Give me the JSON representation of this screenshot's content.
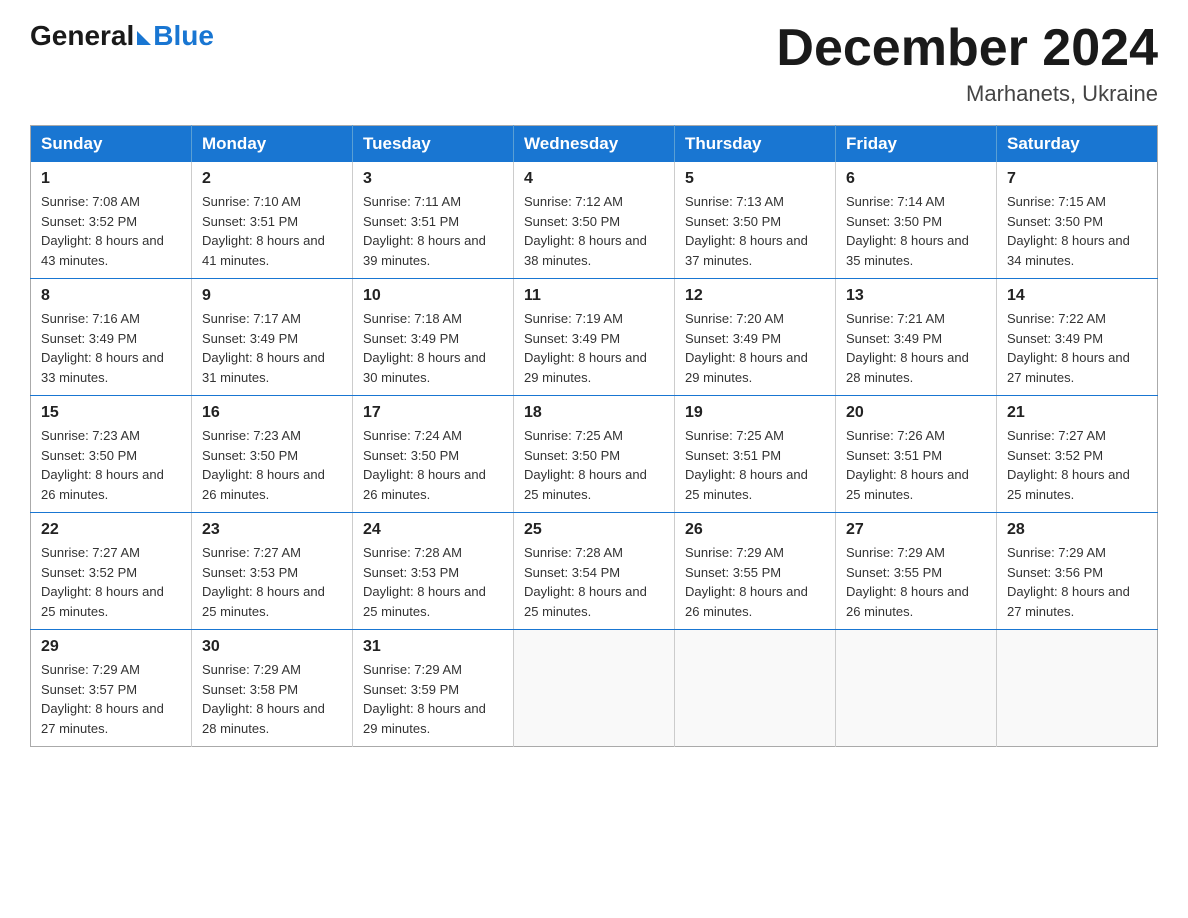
{
  "header": {
    "logo": {
      "general": "General",
      "blue": "Blue"
    },
    "title": "December 2024",
    "location": "Marhanets, Ukraine"
  },
  "calendar": {
    "days_of_week": [
      "Sunday",
      "Monday",
      "Tuesday",
      "Wednesday",
      "Thursday",
      "Friday",
      "Saturday"
    ],
    "weeks": [
      [
        {
          "day": "1",
          "sunrise": "7:08 AM",
          "sunset": "3:52 PM",
          "daylight": "8 hours and 43 minutes."
        },
        {
          "day": "2",
          "sunrise": "7:10 AM",
          "sunset": "3:51 PM",
          "daylight": "8 hours and 41 minutes."
        },
        {
          "day": "3",
          "sunrise": "7:11 AM",
          "sunset": "3:51 PM",
          "daylight": "8 hours and 39 minutes."
        },
        {
          "day": "4",
          "sunrise": "7:12 AM",
          "sunset": "3:50 PM",
          "daylight": "8 hours and 38 minutes."
        },
        {
          "day": "5",
          "sunrise": "7:13 AM",
          "sunset": "3:50 PM",
          "daylight": "8 hours and 37 minutes."
        },
        {
          "day": "6",
          "sunrise": "7:14 AM",
          "sunset": "3:50 PM",
          "daylight": "8 hours and 35 minutes."
        },
        {
          "day": "7",
          "sunrise": "7:15 AM",
          "sunset": "3:50 PM",
          "daylight": "8 hours and 34 minutes."
        }
      ],
      [
        {
          "day": "8",
          "sunrise": "7:16 AM",
          "sunset": "3:49 PM",
          "daylight": "8 hours and 33 minutes."
        },
        {
          "day": "9",
          "sunrise": "7:17 AM",
          "sunset": "3:49 PM",
          "daylight": "8 hours and 31 minutes."
        },
        {
          "day": "10",
          "sunrise": "7:18 AM",
          "sunset": "3:49 PM",
          "daylight": "8 hours and 30 minutes."
        },
        {
          "day": "11",
          "sunrise": "7:19 AM",
          "sunset": "3:49 PM",
          "daylight": "8 hours and 29 minutes."
        },
        {
          "day": "12",
          "sunrise": "7:20 AM",
          "sunset": "3:49 PM",
          "daylight": "8 hours and 29 minutes."
        },
        {
          "day": "13",
          "sunrise": "7:21 AM",
          "sunset": "3:49 PM",
          "daylight": "8 hours and 28 minutes."
        },
        {
          "day": "14",
          "sunrise": "7:22 AM",
          "sunset": "3:49 PM",
          "daylight": "8 hours and 27 minutes."
        }
      ],
      [
        {
          "day": "15",
          "sunrise": "7:23 AM",
          "sunset": "3:50 PM",
          "daylight": "8 hours and 26 minutes."
        },
        {
          "day": "16",
          "sunrise": "7:23 AM",
          "sunset": "3:50 PM",
          "daylight": "8 hours and 26 minutes."
        },
        {
          "day": "17",
          "sunrise": "7:24 AM",
          "sunset": "3:50 PM",
          "daylight": "8 hours and 26 minutes."
        },
        {
          "day": "18",
          "sunrise": "7:25 AM",
          "sunset": "3:50 PM",
          "daylight": "8 hours and 25 minutes."
        },
        {
          "day": "19",
          "sunrise": "7:25 AM",
          "sunset": "3:51 PM",
          "daylight": "8 hours and 25 minutes."
        },
        {
          "day": "20",
          "sunrise": "7:26 AM",
          "sunset": "3:51 PM",
          "daylight": "8 hours and 25 minutes."
        },
        {
          "day": "21",
          "sunrise": "7:27 AM",
          "sunset": "3:52 PM",
          "daylight": "8 hours and 25 minutes."
        }
      ],
      [
        {
          "day": "22",
          "sunrise": "7:27 AM",
          "sunset": "3:52 PM",
          "daylight": "8 hours and 25 minutes."
        },
        {
          "day": "23",
          "sunrise": "7:27 AM",
          "sunset": "3:53 PM",
          "daylight": "8 hours and 25 minutes."
        },
        {
          "day": "24",
          "sunrise": "7:28 AM",
          "sunset": "3:53 PM",
          "daylight": "8 hours and 25 minutes."
        },
        {
          "day": "25",
          "sunrise": "7:28 AM",
          "sunset": "3:54 PM",
          "daylight": "8 hours and 25 minutes."
        },
        {
          "day": "26",
          "sunrise": "7:29 AM",
          "sunset": "3:55 PM",
          "daylight": "8 hours and 26 minutes."
        },
        {
          "day": "27",
          "sunrise": "7:29 AM",
          "sunset": "3:55 PM",
          "daylight": "8 hours and 26 minutes."
        },
        {
          "day": "28",
          "sunrise": "7:29 AM",
          "sunset": "3:56 PM",
          "daylight": "8 hours and 27 minutes."
        }
      ],
      [
        {
          "day": "29",
          "sunrise": "7:29 AM",
          "sunset": "3:57 PM",
          "daylight": "8 hours and 27 minutes."
        },
        {
          "day": "30",
          "sunrise": "7:29 AM",
          "sunset": "3:58 PM",
          "daylight": "8 hours and 28 minutes."
        },
        {
          "day": "31",
          "sunrise": "7:29 AM",
          "sunset": "3:59 PM",
          "daylight": "8 hours and 29 minutes."
        },
        null,
        null,
        null,
        null
      ]
    ]
  }
}
